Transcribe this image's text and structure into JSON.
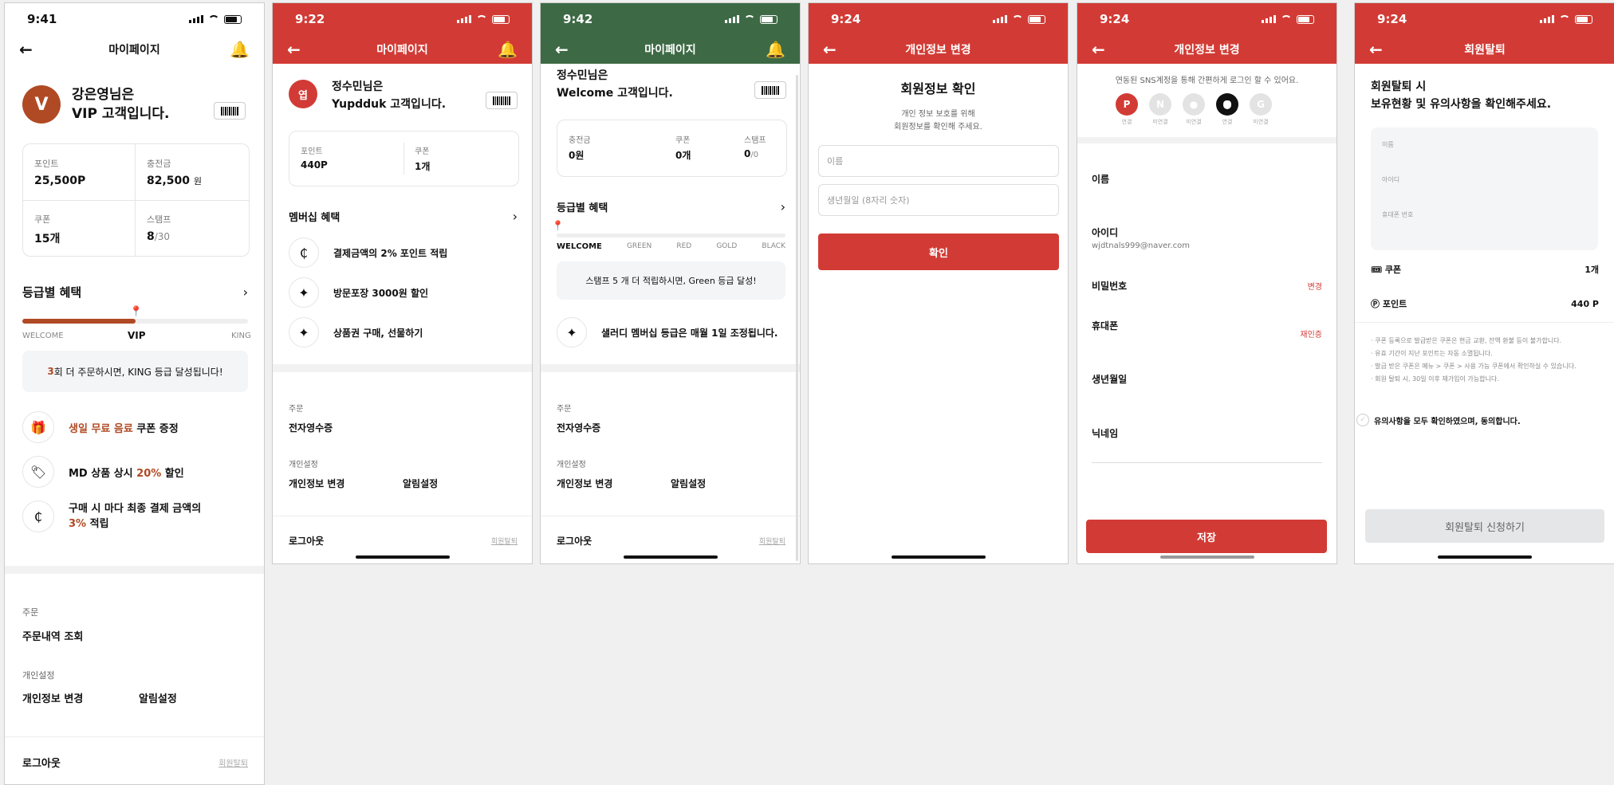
{
  "p1": {
    "status": {
      "time": "9:41"
    },
    "nav": {
      "title": "마이페이지"
    },
    "profile": {
      "avatar_letter": "V",
      "name_line": "강은영님은",
      "grade_line": "VIP 고객입니다."
    },
    "stats": [
      {
        "label": "포인트",
        "value": "25,500P"
      },
      {
        "label": "충전금",
        "value": "82,500",
        "unit": "원"
      },
      {
        "label": "쿠폰",
        "value": "15개"
      },
      {
        "label": "스탬프",
        "value": "8",
        "suffix": "/30"
      }
    ],
    "grade": {
      "title": "등급별 혜택",
      "levels": [
        "WELCOME",
        "VIP",
        "KING"
      ],
      "progress": 0.5,
      "notice_num": "3",
      "notice_text": "회 더 주문하시면, KING 등급 달성됩니다!"
    },
    "benefits": [
      {
        "icon": "gift-icon",
        "hl": "생일 무료 음료",
        "rest": " 쿠폰 증정"
      },
      {
        "icon": "tag-icon",
        "pre": "MD 상품 상시 ",
        "hl": "20%",
        "rest": " 할인"
      },
      {
        "icon": "coin-icon",
        "pre": "구매 시 마다 최종 결제 금액의",
        "hl": "3%",
        "rest": " 적립"
      }
    ],
    "order": {
      "section": "주문",
      "item": "주문내역 조회"
    },
    "settings": {
      "section": "개인설정",
      "items": [
        "개인정보 변경",
        "알림설정"
      ]
    },
    "footer": {
      "logout": "로그아웃",
      "withdraw": "회원탈퇴"
    }
  },
  "p2": {
    "status": {
      "time": "9:22"
    },
    "nav": {
      "title": "마이페이지"
    },
    "profile": {
      "name_line": "정수민님은",
      "grade_line": "Yupdduk 고객입니다."
    },
    "stats": [
      {
        "label": "포인트",
        "value": "440P"
      },
      {
        "label": "쿠폰",
        "value": "1개"
      }
    ],
    "membership": {
      "title": "멤버십 혜택",
      "items": [
        {
          "icon": "coin-icon",
          "text": "결제금액의 2% 포인트 적립"
        },
        {
          "icon": "sparkle-icon",
          "text": "방문포장 3000원 할인"
        },
        {
          "icon": "sparkle-icon",
          "text": "상품권 구매, 선물하기"
        }
      ]
    },
    "order": {
      "section": "주문",
      "item": "전자영수증"
    },
    "settings": {
      "section": "개인설정",
      "items": [
        "개인정보 변경",
        "알림설정"
      ]
    },
    "footer": {
      "logout": "로그아웃",
      "withdraw": "회원탈퇴"
    }
  },
  "p3": {
    "status": {
      "time": "9:42"
    },
    "nav": {
      "title": "마이페이지"
    },
    "profile": {
      "name_line": "정수민님은",
      "grade_line": "Welcome 고객입니다."
    },
    "stats": [
      {
        "label": "충전금",
        "value": "0원"
      },
      {
        "label": "쿠폰",
        "value": "0개"
      },
      {
        "label": "스탬프",
        "value": "0",
        "suffix": "/0"
      }
    ],
    "grade": {
      "title": "등급별 혜택",
      "levels": [
        "WELCOME",
        "GREEN",
        "RED",
        "GOLD",
        "BLACK"
      ],
      "progress": 0.0,
      "notice": "스탬프 5 개 더 적립하시면, Green 등급 달성!"
    },
    "info": "샐러디 멤버십 등급은 매월 1일 조정됩니다.",
    "order": {
      "section": "주문",
      "item": "전자영수증"
    },
    "settings": {
      "section": "개인설정",
      "items": [
        "개인정보 변경",
        "알림설정"
      ]
    },
    "footer": {
      "logout": "로그아웃",
      "withdraw": "회원탈퇴"
    }
  },
  "p4": {
    "status": {
      "time": "9:24"
    },
    "nav": {
      "title": "개인정보 변경"
    },
    "heading": "회원정보 확인",
    "desc1": "개인 정보 보호를 위해",
    "desc2": "회원정보를 확인해 주세요.",
    "name_placeholder": "이름",
    "birth_placeholder": "생년월일 (8자리 숫자)",
    "confirm": "확인"
  },
  "p5": {
    "status": {
      "time": "9:24"
    },
    "nav": {
      "title": "개인정보 변경"
    },
    "sns_text": "연동된 SNS계정을 통해 간편하게 로그인 할 수 있어요.",
    "sns": [
      {
        "glyph": "P",
        "label": "연결",
        "color": "#d23b35"
      },
      {
        "glyph": "N",
        "label": "미연결",
        "color": "#e3e3e3"
      },
      {
        "glyph": "●",
        "label": "미연결",
        "color": "#e3e3e3"
      },
      {
        "glyph": "",
        "label": "연결",
        "color": "#111111"
      },
      {
        "glyph": "G",
        "label": "미연결",
        "color": "#e3e3e3"
      }
    ],
    "fields": {
      "name": "이름",
      "id": "아이디",
      "id_value": "wjdtnals999@naver.com",
      "password": "비밀번호",
      "password_action": "변경",
      "phone": "휴대폰",
      "phone_action": "재인증",
      "birth": "생년월일",
      "nickname": "닉네임"
    },
    "save": "저장"
  },
  "p6": {
    "status": {
      "time": "9:24"
    },
    "nav": {
      "title": "회원탈퇴"
    },
    "heading1": "회원탈퇴 시",
    "heading2": "보유현황 및 유의사항을 확인해주세요.",
    "info_labels": [
      "이름",
      "아이디",
      "휴대폰 번호"
    ],
    "coupon": {
      "label": "쿠폰",
      "value": "1개"
    },
    "point": {
      "label": "포인트",
      "value": "440 P"
    },
    "notes": [
      "· 쿠폰 등록으로 발급받은 쿠폰은 현금 교환, 잔액 환불 등이 불가합니다.",
      "· 유효 기간이 지난 포인트는 자동 소멸됩니다.",
      "· 발급 받은 쿠폰은 메뉴 > 쿠폰 > 사용 가능 쿠폰에서 확인하실 수 있습니다.",
      "· 회원 탈퇴 시, 30일 이후 재가입이 가능합니다."
    ],
    "agree": "유의사항을 모두 확인하였으며, 동의합니다.",
    "submit": "회원탈퇴 신청하기"
  }
}
